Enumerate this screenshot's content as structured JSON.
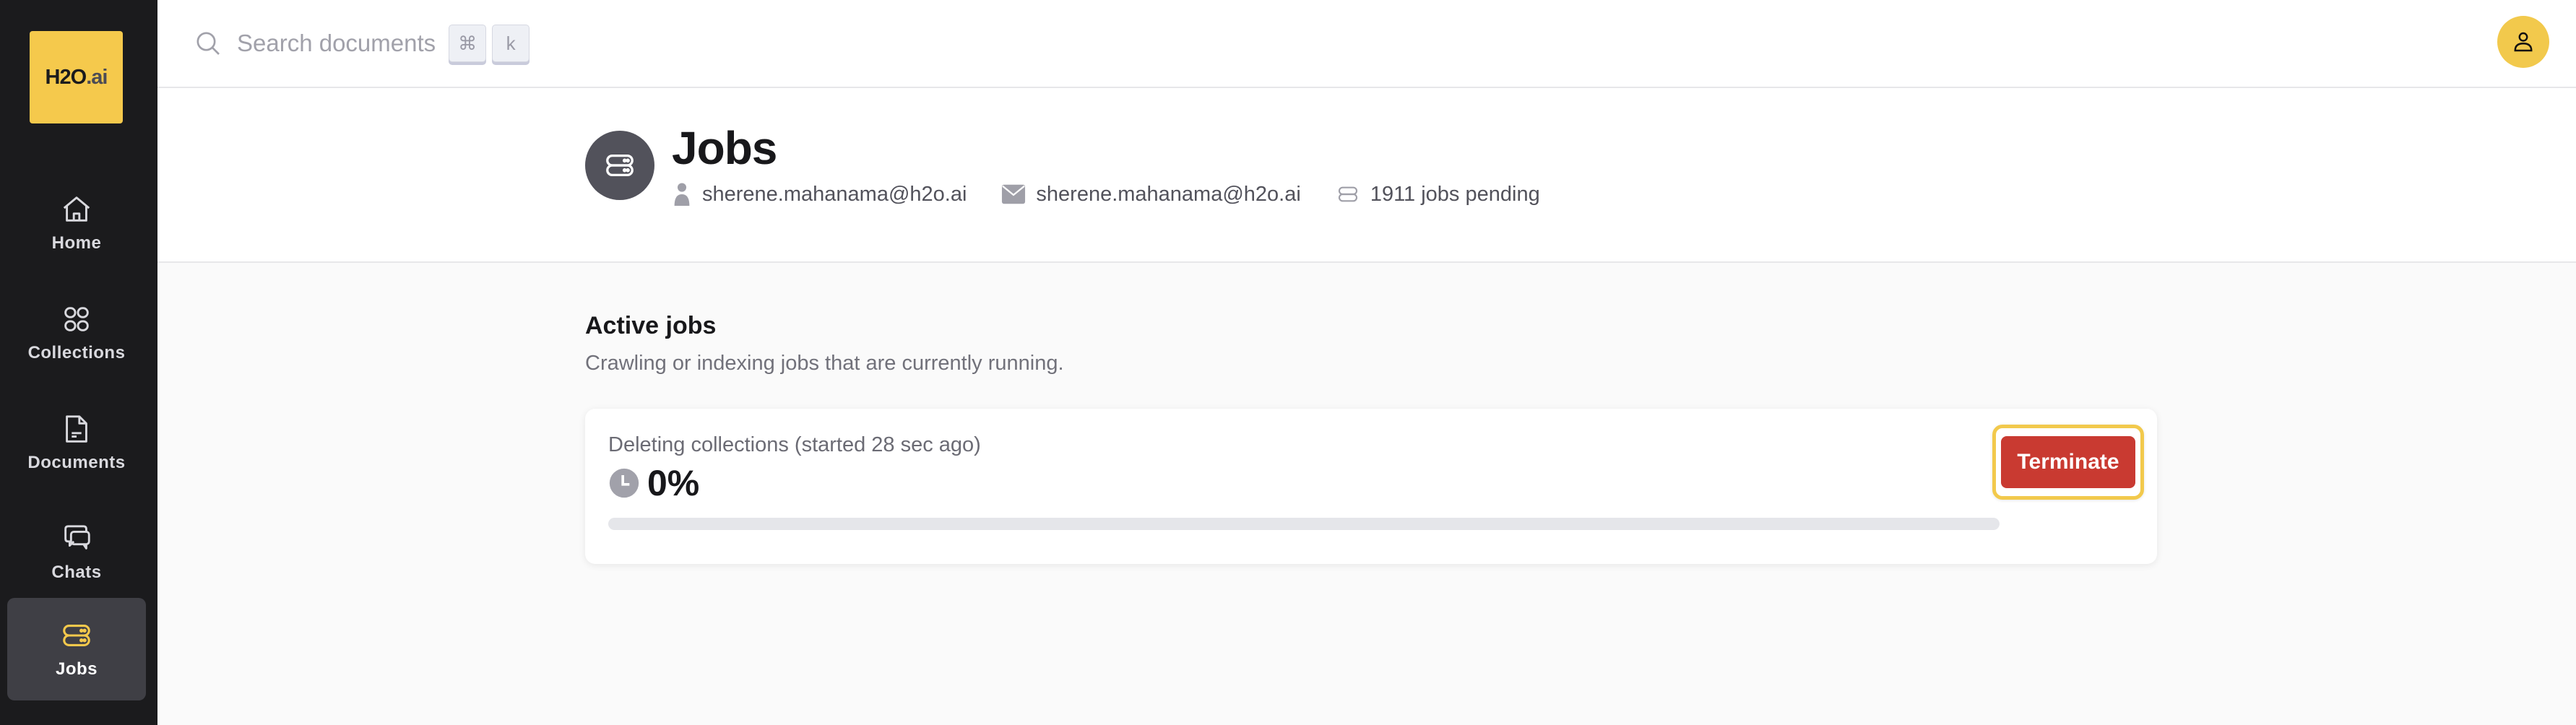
{
  "brand": {
    "logo_main": "H2O",
    "logo_suffix": ".ai",
    "accent": "#f5c94c"
  },
  "sidebar": {
    "items": [
      {
        "label": "Home",
        "icon": "home-icon",
        "active": false
      },
      {
        "label": "Collections",
        "icon": "collections-icon",
        "active": false
      },
      {
        "label": "Documents",
        "icon": "document-icon",
        "active": false
      },
      {
        "label": "Chats",
        "icon": "chats-icon",
        "active": false
      },
      {
        "label": "Jobs",
        "icon": "jobs-icon",
        "active": true
      }
    ]
  },
  "header": {
    "search_placeholder": "Search documents",
    "shortcut_keys": [
      "⌘",
      "k"
    ],
    "avatar_icon": "user-icon"
  },
  "page": {
    "title": "Jobs",
    "meta": {
      "username": "sherene.mahanama@h2o.ai",
      "email": "sherene.mahanama@h2o.ai",
      "pending": "1911 jobs pending"
    }
  },
  "active_jobs": {
    "title": "Active jobs",
    "subtitle": "Crawling or indexing jobs that are currently running.",
    "jobs": [
      {
        "description": "Deleting collections (started 28 sec ago)",
        "progress_label": "0%",
        "progress": 0,
        "action_label": "Terminate",
        "action_color": "#c93a31"
      }
    ]
  }
}
